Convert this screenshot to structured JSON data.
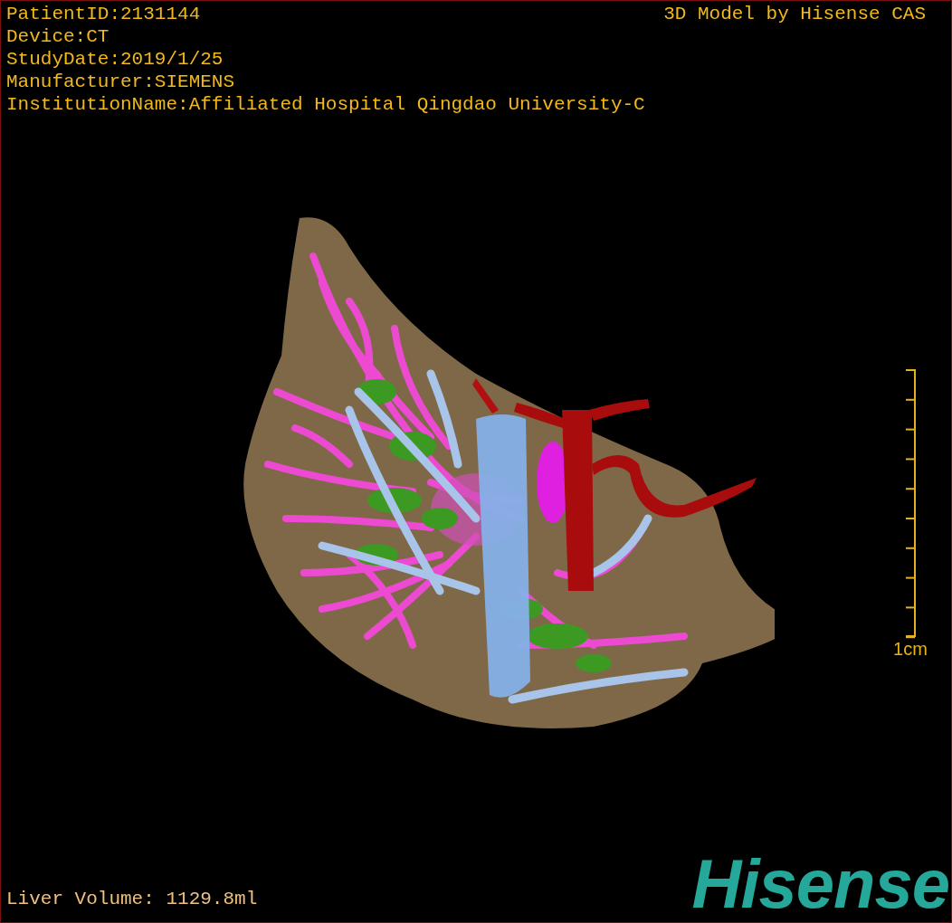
{
  "overlay": {
    "info_lines": [
      "PatientID:2131144",
      "Device:CT",
      "StudyDate:2019/1/25",
      "Manufacturer:SIEMENS",
      "InstitutionName:Affiliated Hospital Qingdao University-C"
    ],
    "credit": "3D Model by Hisense CAS"
  },
  "scale_bar": {
    "label": "1cm"
  },
  "liver_volume": "Liver Volume: 1129.8ml",
  "logo": "Hisense"
}
